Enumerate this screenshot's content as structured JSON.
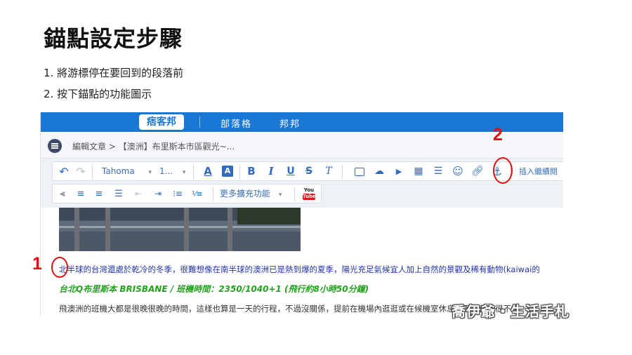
{
  "slide": {
    "title": "錨點設定步驟",
    "steps": [
      "1. 將游標停在要回到的段落前",
      "2. 按下錨點的功能圖示"
    ]
  },
  "app": {
    "logo": "痞客邦",
    "nav": [
      "部落格",
      "邦邦"
    ],
    "breadcrumb": "編輯文章 > 【澳洲】布里斯本市區觀光~...",
    "accent_color": "#1a78d4"
  },
  "toolbar": {
    "row1": {
      "undo_icon": "undo-icon",
      "redo_icon": "redo-icon",
      "font_family": "Tahoma",
      "font_size": "1...",
      "text_color_label": "A",
      "bg_color_label": "A",
      "bold": "B",
      "italic": "I",
      "underline": "U",
      "strike": "S",
      "clear_format": "T",
      "icons": [
        "image-icon",
        "upload-icon",
        "video-icon",
        "table-icon",
        "horizontal-line-icon",
        "emoji-icon",
        "link-icon",
        "anchor-icon"
      ],
      "insert_more": "插入繼續閱"
    },
    "row2": {
      "more_features": "更多擴充功能",
      "youtube_label_top": "You",
      "youtube_label_bottom": "Tube"
    }
  },
  "content": {
    "para1": "北半球的台灣還處於乾冷的冬季，很難想像在南半球的澳洲已是熱到爆的夏季，陽光充足氣候宜人加上自然的景觀及稀有動物(kaiwai的",
    "para2": "台北Q布里斯本 BRISBANE / 班機時間：2350/1040+1 (飛行約8小時50分鐘)",
    "para3": "飛澳洲的班機大都是很晚很晚的時間，這樣也算是一天的行程，不過沒關係，提前在機場內逛逛或在候機室休息一下，都是很不錯"
  },
  "annotations": {
    "marker1": "1",
    "marker2": "2",
    "color": "#e10f0f"
  },
  "watermark": "喬伊爺・生活手札"
}
